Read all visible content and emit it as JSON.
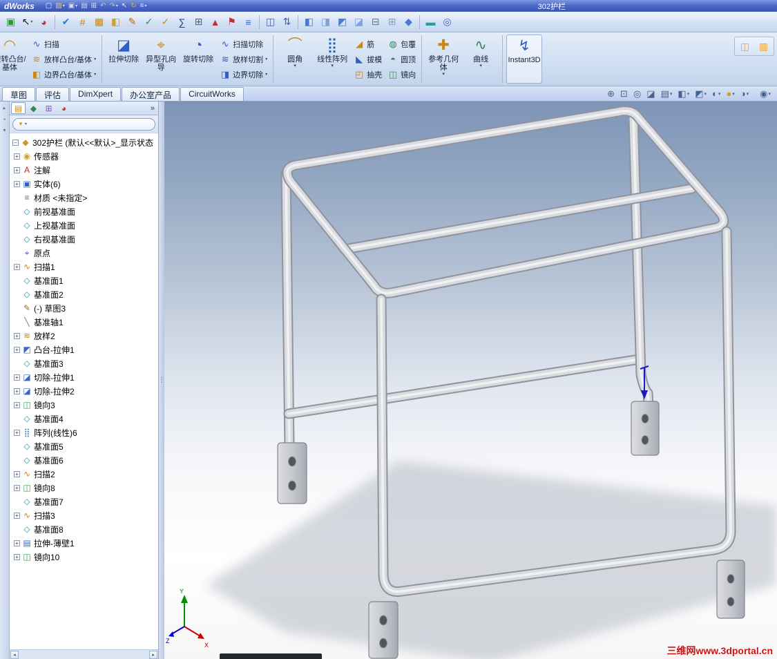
{
  "title_bar": {
    "logo_fragment": "dWorks",
    "doc_title": "302护栏",
    "icons": [
      {
        "name": "new-document-icon",
        "glyph": "▢",
        "color": "#f0f4fa"
      },
      {
        "name": "open-icon",
        "glyph": "▨",
        "color": "#e8c860",
        "caret": true
      },
      {
        "name": "save-icon",
        "glyph": "▣",
        "color": "#cdd8ee",
        "caret": true
      },
      {
        "name": "print-icon",
        "glyph": "▤",
        "color": "#cdd8ee"
      },
      {
        "name": "copy-icon",
        "glyph": "⊞",
        "color": "#d8e0f2"
      },
      {
        "name": "undo-icon",
        "glyph": "↶",
        "color": "#9fd89f"
      },
      {
        "name": "redo-icon",
        "glyph": "↷",
        "color": "#9fd89f",
        "caret": true
      },
      {
        "name": "select-icon",
        "glyph": "↖",
        "color": "#e8ecf4"
      },
      {
        "name": "rebuild-icon",
        "glyph": "↻",
        "color": "#d8b050"
      },
      {
        "name": "options-icon",
        "glyph": "≡",
        "color": "#e0e6f2",
        "caret": true
      }
    ]
  },
  "toolbar": {
    "icons": [
      {
        "name": "app-cube-icon",
        "glyph": "▣",
        "color": "#2a9a3a"
      },
      {
        "name": "select-tool-icon",
        "glyph": "↖",
        "color": "#14181e",
        "caret": true
      },
      {
        "name": "dimxpert-ball-icon",
        "glyph": "◕",
        "color": "#c03030"
      },
      {
        "sep": true
      },
      {
        "name": "spell-check-icon",
        "glyph": "✔",
        "color": "#2a7ad0"
      },
      {
        "name": "grid-icon",
        "glyph": "#",
        "color": "#c08a20"
      },
      {
        "name": "table-icon",
        "glyph": "▦",
        "color": "#c08a20"
      },
      {
        "name": "photo-icon",
        "glyph": "◧",
        "color": "#caa23a"
      },
      {
        "name": "sketch-entity-icon",
        "glyph": "✎",
        "color": "#b06a20"
      },
      {
        "name": "check-green-icon",
        "glyph": "✓",
        "color": "#2a9a3a"
      },
      {
        "name": "check-orange-icon",
        "glyph": "✓",
        "color": "#c08a20"
      },
      {
        "name": "equations-icon",
        "glyph": "∑",
        "color": "#1a3a80"
      },
      {
        "name": "pattern-grid-icon",
        "glyph": "⊞",
        "color": "#3a62c8"
      },
      {
        "name": "triad-icon",
        "glyph": "▲",
        "color": "#c03030"
      },
      {
        "name": "flag-icon",
        "glyph": "⚑",
        "color": "#c03030"
      },
      {
        "name": "notes-icon",
        "glyph": "≡",
        "color": "#3a62c8"
      },
      {
        "sep": true
      },
      {
        "name": "window-pair-icon",
        "glyph": "◫",
        "color": "#3a62c8"
      },
      {
        "name": "swap-view-icon",
        "glyph": "⇅",
        "color": "#3a62c8"
      },
      {
        "sep": true
      },
      {
        "name": "view-front-icon",
        "glyph": "◧",
        "color": "#4a7ad0"
      },
      {
        "name": "view-back-icon",
        "glyph": "◨",
        "color": "#7aa2e0"
      },
      {
        "name": "view-left-icon",
        "glyph": "◩",
        "color": "#4a7ad0"
      },
      {
        "name": "view-right-icon",
        "glyph": "◪",
        "color": "#7aa2e0"
      },
      {
        "name": "view-top-icon",
        "glyph": "⊟",
        "color": "#4a7ad0"
      },
      {
        "name": "view-bottom-icon",
        "glyph": "⊞",
        "color": "#7aa2e0"
      },
      {
        "name": "view-iso-icon",
        "glyph": "◆",
        "color": "#4a7ad0"
      },
      {
        "sep": true
      },
      {
        "name": "measure-ruler-icon",
        "glyph": "▬",
        "color": "#2a9aa0"
      },
      {
        "name": "mass-properties-icon",
        "glyph": "◎",
        "color": "#3a62c8"
      }
    ]
  },
  "ribbon": {
    "groups": [
      {
        "type": "big",
        "name": "revolved-boss-base",
        "label": "旋转凸台/基体",
        "glyph": "◠",
        "color": "#c8881a",
        "clipped": true
      },
      {
        "type": "stack",
        "name": "boss-stack",
        "sep_after": true,
        "items": [
          {
            "name": "swept-boss-base",
            "label": "扫描",
            "glyph": "∿",
            "color": "#2f5fc0"
          },
          {
            "name": "lofted-boss-base",
            "label": "放样凸台/基体",
            "glyph": "≋",
            "color": "#c8881a",
            "caret": true
          },
          {
            "name": "boundary-boss-base",
            "label": "边界凸台/基体",
            "glyph": "◧",
            "color": "#c8881a",
            "caret": true
          }
        ]
      },
      {
        "type": "big",
        "name": "extruded-cut",
        "label": "拉伸切除",
        "glyph": "◪",
        "color": "#2f5fc0"
      },
      {
        "type": "big",
        "name": "hole-wizard",
        "label": "异型孔向导",
        "glyph": "⌖",
        "color": "#c8881a"
      },
      {
        "type": "big",
        "name": "revolved-cut",
        "label": "旋转切除",
        "glyph": "◔",
        "color": "#2f5fc0"
      },
      {
        "type": "stack",
        "name": "cut-stack",
        "sep_after": true,
        "items": [
          {
            "name": "swept-cut",
            "label": "扫描切除",
            "glyph": "∿",
            "color": "#2f5fc0"
          },
          {
            "name": "lofted-cut",
            "label": "放样切割",
            "glyph": "≋",
            "color": "#2f5fc0",
            "caret": true
          },
          {
            "name": "boundary-cut",
            "label": "边界切除",
            "glyph": "◨",
            "color": "#2f5fc0",
            "caret": true
          }
        ]
      },
      {
        "type": "big",
        "name": "fillet",
        "label": "圆角",
        "glyph": "⌒",
        "color": "#c8881a",
        "caret": true
      },
      {
        "type": "big",
        "name": "linear-pattern",
        "label": "线性阵列",
        "glyph": "⣿",
        "color": "#2f5fc0",
        "caret": true
      },
      {
        "type": "stack",
        "name": "rib-draft-shell-stack",
        "items": [
          {
            "name": "rib",
            "label": "筋",
            "glyph": "◢",
            "color": "#c8881a"
          },
          {
            "name": "draft",
            "label": "拔模",
            "glyph": "◣",
            "color": "#2f5fc0"
          },
          {
            "name": "shell",
            "label": "抽壳",
            "glyph": "◰",
            "color": "#c8881a"
          }
        ]
      },
      {
        "type": "stack",
        "name": "wrap-dome-mirror-stack",
        "sep_after": true,
        "items": [
          {
            "name": "wrap",
            "label": "包覆",
            "glyph": "◍",
            "color": "#2f8a5a"
          },
          {
            "name": "dome",
            "label": "圆顶",
            "glyph": "◓",
            "color": "#2f8a5a"
          },
          {
            "name": "mirror",
            "label": "镜向",
            "glyph": "◫",
            "color": "#3a9a4a"
          }
        ]
      },
      {
        "type": "big",
        "name": "reference-geometry",
        "label": "参考几何体",
        "glyph": "✚",
        "color": "#c8881a",
        "caret": true
      },
      {
        "type": "big",
        "name": "curves",
        "label": "曲线",
        "glyph": "∿",
        "color": "#2f8a5a",
        "caret": true,
        "sep_after": true
      },
      {
        "type": "big",
        "name": "instant3d",
        "label": "Instant3D",
        "glyph": "↯",
        "color": "#2f5fc0",
        "active": true
      }
    ],
    "right_icons": [
      {
        "name": "task-pane-icon",
        "glyph": "◫",
        "color": "#e8a33a"
      },
      {
        "name": "display-pane-icon",
        "glyph": "▥",
        "color": "#e8a33a"
      }
    ]
  },
  "tab_bar": {
    "tabs": [
      {
        "label": "草图",
        "active": true
      },
      {
        "label": "评估"
      },
      {
        "label": "DimXpert"
      },
      {
        "label": "办公室产品"
      },
      {
        "label": "CircuitWorks"
      }
    ],
    "settings_icon": {
      "name": "quick-settings-icon",
      "glyph": "◉",
      "color": "#46628e",
      "caret": true
    }
  },
  "hud": {
    "icons": [
      {
        "name": "zoom-fit-icon",
        "glyph": "⊕"
      },
      {
        "name": "zoom-area-icon",
        "glyph": "⊡"
      },
      {
        "name": "zoom-previous-icon",
        "glyph": "◎"
      },
      {
        "name": "section-view-icon",
        "glyph": "◪"
      },
      {
        "name": "annotation-views-icon",
        "glyph": "▤",
        "caret": true
      },
      {
        "name": "view-orientation-icon",
        "glyph": "◧",
        "caret": true
      },
      {
        "name": "display-style-icon",
        "glyph": "◩",
        "caret": true
      },
      {
        "name": "hide-show-items-icon",
        "glyph": "◐",
        "caret": true
      },
      {
        "name": "appearance-icon",
        "glyph": "●",
        "color": "#c8a030",
        "caret": true
      },
      {
        "name": "scene-icon",
        "glyph": "◑",
        "caret": true
      }
    ]
  },
  "side_strip": {
    "icons": [
      {
        "name": "pin-icon",
        "glyph": "▸"
      },
      {
        "name": "pane-icon",
        "glyph": "▪"
      },
      {
        "name": "collapse-icon",
        "glyph": "▾"
      }
    ]
  },
  "panel": {
    "header_icons": [
      {
        "name": "featuremanager-tab-icon",
        "glyph": "▤",
        "color": "#c8881a",
        "active": true
      },
      {
        "name": "propertymanager-tab-icon",
        "glyph": "◆",
        "color": "#2a8a5a"
      },
      {
        "name": "configurationmanager-tab-icon",
        "glyph": "⊞",
        "color": "#8a5ac0"
      },
      {
        "name": "dimxpertmanager-tab-icon",
        "glyph": "◕",
        "color": "#c03030"
      }
    ],
    "chevron": "»",
    "filter": {
      "funnel_glyph": "▼"
    },
    "tree": {
      "root_label": "302护栏 (默认<<默认>_显示状态",
      "items": [
        {
          "label": "传感器",
          "icon": "sensors-icon",
          "glyph": "◉",
          "color": "#caa23a",
          "plus": true
        },
        {
          "label": "注解",
          "icon": "annotations-icon",
          "glyph": "A",
          "color": "#cc2222",
          "plus": true
        },
        {
          "label": "实体(6)",
          "icon": "solid-bodies-folder-icon",
          "glyph": "▣",
          "color": "#2f5fc0",
          "plus": true
        },
        {
          "label": "材质 <未指定>",
          "icon": "material-icon",
          "glyph": "≡",
          "color": "#8a6a4a",
          "plus": false
        },
        {
          "label": "前视基准面",
          "icon": "plane-icon",
          "glyph": "◇",
          "color": "#1898a8",
          "plus": false
        },
        {
          "label": "上视基准面",
          "icon": "plane-icon",
          "glyph": "◇",
          "color": "#1898a8",
          "plus": false
        },
        {
          "label": "右视基准面",
          "icon": "plane-icon",
          "glyph": "◇",
          "color": "#1898a8",
          "plus": false
        },
        {
          "label": "原点",
          "icon": "origin-icon",
          "glyph": "⌖",
          "color": "#3a5fb0",
          "plus": false
        },
        {
          "label": "扫描1",
          "icon": "sweep-icon",
          "glyph": "∿",
          "color": "#c8821a",
          "plus": true
        },
        {
          "label": "基准面1",
          "icon": "plane-icon",
          "glyph": "◇",
          "color": "#1898a8",
          "plus": false
        },
        {
          "label": "基准面2",
          "icon": "plane-icon",
          "glyph": "◇",
          "color": "#1898a8",
          "plus": false
        },
        {
          "label": "(-) 草图3",
          "icon": "sketch-icon",
          "glyph": "✎",
          "color": "#9a6a2a",
          "plus": false
        },
        {
          "label": "基准轴1",
          "icon": "axis-icon",
          "glyph": "╲",
          "color": "#70747c",
          "plus": false
        },
        {
          "label": "放样2",
          "icon": "loft-icon",
          "glyph": "≋",
          "color": "#c8821a",
          "plus": true
        },
        {
          "label": "凸台-拉伸1",
          "icon": "boss-extrude-icon",
          "glyph": "◩",
          "color": "#3a6ac0",
          "plus": true
        },
        {
          "label": "基准面3",
          "icon": "plane-icon",
          "glyph": "◇",
          "color": "#1898a8",
          "plus": false
        },
        {
          "label": "切除-拉伸1",
          "icon": "cut-extrude-icon",
          "glyph": "◪",
          "color": "#3a6ac0",
          "plus": true
        },
        {
          "label": "切除-拉伸2",
          "icon": "cut-extrude-icon",
          "glyph": "◪",
          "color": "#3a6ac0",
          "plus": true
        },
        {
          "label": "镜向3",
          "icon": "mirror-icon",
          "glyph": "◫",
          "color": "#3a9a4a",
          "plus": true
        },
        {
          "label": "基准面4",
          "icon": "plane-icon",
          "glyph": "◇",
          "color": "#1898a8",
          "plus": false
        },
        {
          "label": "阵列(线性)6",
          "icon": "linear-pattern-icon",
          "glyph": "⣿",
          "color": "#3a6ac0",
          "plus": true
        },
        {
          "label": "基准面5",
          "icon": "plane-icon",
          "glyph": "◇",
          "color": "#1898a8",
          "plus": false
        },
        {
          "label": "基准面6",
          "icon": "plane-icon",
          "glyph": "◇",
          "color": "#1898a8",
          "plus": false
        },
        {
          "label": "扫描2",
          "icon": "sweep-icon",
          "glyph": "∿",
          "color": "#c8821a",
          "plus": true
        },
        {
          "label": "镜向8",
          "icon": "mirror-icon",
          "glyph": "◫",
          "color": "#3a9a4a",
          "plus": true
        },
        {
          "label": "基准面7",
          "icon": "plane-icon",
          "glyph": "◇",
          "color": "#1898a8",
          "plus": false
        },
        {
          "label": "扫描3",
          "icon": "sweep-icon",
          "glyph": "∿",
          "color": "#c8821a",
          "plus": true
        },
        {
          "label": "基准面8",
          "icon": "plane-icon",
          "glyph": "◇",
          "color": "#1898a8",
          "plus": false
        },
        {
          "label": "拉伸-薄壁1",
          "icon": "thin-extrude-icon",
          "glyph": "▤",
          "color": "#3a6ac0",
          "plus": true
        },
        {
          "label": "镜向10",
          "icon": "mirror-icon",
          "glyph": "◫",
          "color": "#3a9a4a",
          "plus": true
        }
      ]
    }
  },
  "viewport": {
    "watermark": "三维网www.3dportal.cn",
    "triad": {
      "x": "X",
      "y": "Y",
      "z": "Z"
    }
  }
}
